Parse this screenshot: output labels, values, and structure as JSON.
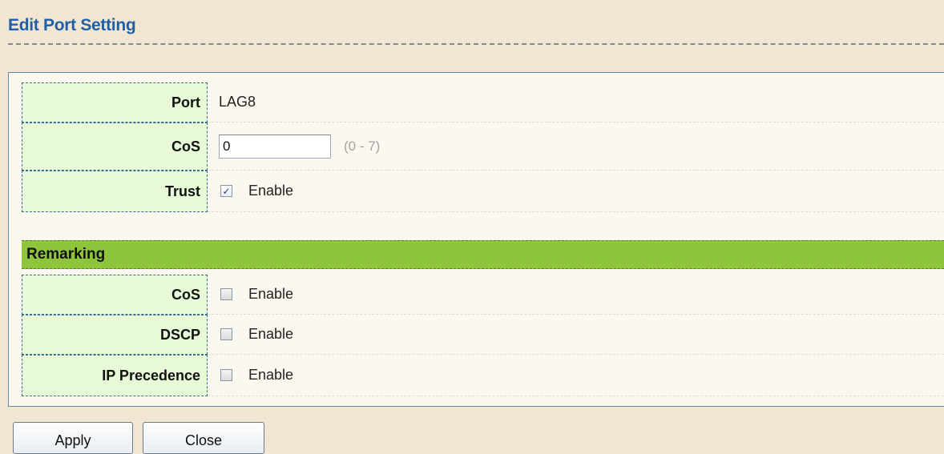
{
  "page": {
    "title": "Edit Port Setting"
  },
  "port_row": {
    "label": "Port",
    "value": "LAG8"
  },
  "cos_row": {
    "label": "CoS",
    "input_value": "0",
    "range_hint": "(0 - 7)"
  },
  "trust_row": {
    "label": "Trust",
    "checked": true,
    "checkbox_label": "Enable"
  },
  "remarking": {
    "section_title": "Remarking",
    "rows": [
      {
        "label": "CoS",
        "checked": false,
        "checkbox_label": "Enable"
      },
      {
        "label": "DSCP",
        "checked": false,
        "checkbox_label": "Enable"
      },
      {
        "label": "IP Precedence",
        "checked": false,
        "checkbox_label": "Enable"
      }
    ]
  },
  "buttons": {
    "apply_label": "Apply",
    "close_label": "Close"
  },
  "colors": {
    "title": "#1f5fa8",
    "background": "#f1e6d3",
    "label_cell": "#e7f9d7",
    "section_header": "#8ec53a",
    "panel_border": "#5e87b3"
  },
  "icons": {
    "checked_mark": "check-icon"
  }
}
